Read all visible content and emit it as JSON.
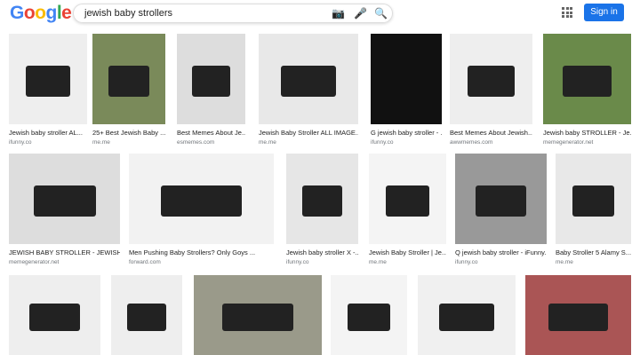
{
  "header": {
    "logo": "Google",
    "query": "jewish baby strollers",
    "camera_icon": "camera-icon",
    "mic_icon": "mic-icon",
    "search_icon": "search-icon",
    "apps_icon": "apps-grid-icon",
    "sign_in": "Sign in",
    "accent": "#1a73e8"
  },
  "rows": [
    [
      {
        "cap": "Jewish baby stroller AL...",
        "src": "ifunny.co"
      },
      {
        "cap": "25+ Best Jewish Baby ...",
        "src": "me.me"
      },
      {
        "cap": "Best Memes About Je...",
        "src": "esmemes.com"
      },
      {
        "cap": "Jewish Baby Stroller ALL IMAGE...",
        "src": "me.me"
      },
      {
        "cap": "G jewish baby stroller - ...",
        "src": "ifunny.co"
      },
      {
        "cap": "Best Memes About Jewish...",
        "src": "awwmemes.com"
      },
      {
        "cap": "Jewish baby STROLLER - Je...",
        "src": "memegenerator.net"
      }
    ],
    [
      {
        "cap": "JEWISH BABY STROLLER - JEWISH ...",
        "src": "memegenerator.net"
      },
      {
        "cap": "Men Pushing Baby Strollers? Only Goys ...",
        "src": "forward.com"
      },
      {
        "cap": "Jewish baby stroller X -...",
        "src": "ifunny.co"
      },
      {
        "cap": "Jewish Baby Stroller | Je...",
        "src": "me.me"
      },
      {
        "cap": "Q jewish baby stroller - iFunny...",
        "src": "ifunny.co"
      },
      {
        "cap": "Baby Stroller 5 Alamy S...",
        "src": "me.me"
      }
    ],
    [
      {
        "cap": "",
        "src": ""
      },
      {
        "cap": "",
        "src": ""
      },
      {
        "cap": "",
        "src": ""
      },
      {
        "cap": "",
        "src": ""
      },
      {
        "cap": "",
        "src": ""
      },
      {
        "cap": "",
        "src": ""
      }
    ]
  ]
}
